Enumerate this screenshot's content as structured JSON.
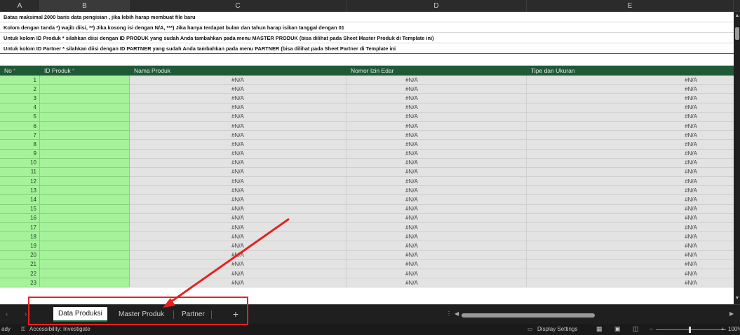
{
  "columns": [
    {
      "letter": "A",
      "width": 57
    },
    {
      "letter": "B",
      "width": 128
    },
    {
      "letter": "C",
      "width": 309
    },
    {
      "letter": "D",
      "width": 257
    },
    {
      "letter": "E",
      "width": 304
    }
  ],
  "notes": [
    "Batas maksimal 2000 baris data pengisian , jika lebih harap membuat file baru",
    "Kolom dengan tanda *) wajib diisi, **) Jika kosong isi dengan N/A, ***) Jika hanya terdapat bulan dan tahun harap isikan tanggal dengan 01",
    "Untuk kolom ID Produk * silahkan diisi dengan ID PRODUK yang sudah Anda tambahkan pada menu MASTER PRODUK (bisa dilihat pada Sheet Master Produk di Template ini)",
    "Untuk kolom ID Partner * silahkan diisi dengan ID PARTNER yang sudah Anda tambahkan pada menu PARTNER (bisa dilihat pada Sheet Partner di Template ini"
  ],
  "table": {
    "headers": [
      "No",
      "ID Produk",
      "Nama Produk",
      "Nomor Izin Edar",
      "Tipe dan Ukuran"
    ],
    "required_mark": "*",
    "na_value": "#N/A",
    "row_numbers": [
      "1",
      "2",
      "3",
      "4",
      "5",
      "6",
      "7",
      "8",
      "9",
      "10",
      "11",
      "12",
      "13",
      "14",
      "15",
      "16",
      "17",
      "18",
      "19",
      "20",
      "21",
      "22",
      "23"
    ]
  },
  "tabs": {
    "prev_icon": "chevron-left-icon",
    "next_icon": "chevron-right-icon",
    "items": [
      "Data Produksi",
      "Master Produk",
      "Partner"
    ],
    "active": "Data Produksi",
    "add_label": "+"
  },
  "statusbar": {
    "ready": "ady",
    "accessibility": "Accessibility: Investigate",
    "display_settings": "Display Settings",
    "zoom_minus": "−",
    "zoom_plus": "+",
    "zoom": "100%"
  },
  "colors": {
    "header_green": "#1e5a36",
    "input_green": "#a6f29b",
    "annotation_red": "#e52222"
  }
}
